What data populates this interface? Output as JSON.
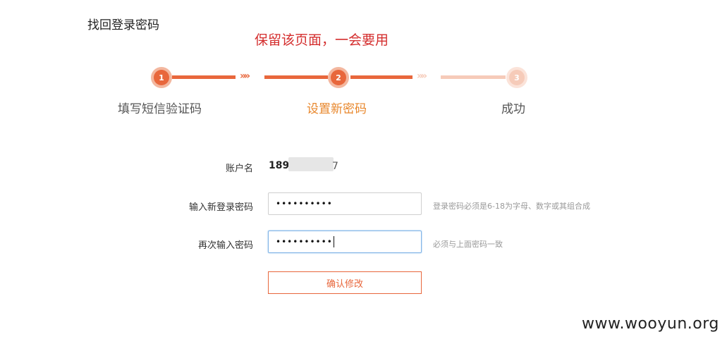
{
  "page": {
    "title": "找回登录密码"
  },
  "annotation": {
    "text": "保留该页面，一会要用"
  },
  "steps": [
    {
      "number": "1",
      "label": "填写短信验证码",
      "state": "done"
    },
    {
      "number": "2",
      "label": "设置新密码",
      "state": "current"
    },
    {
      "number": "3",
      "label": "成功",
      "state": "todo"
    }
  ],
  "stepper": {
    "arrows": "»»"
  },
  "form": {
    "account": {
      "label": "账户名",
      "value": "189",
      "tail": "7"
    },
    "new_password": {
      "label": "输入新登录密码",
      "value": "••••••••••",
      "hint": "登录密码必须是6-18为字母、数字或其组合成"
    },
    "confirm_password": {
      "label": "再次输入密码",
      "value": "••••••••••",
      "hint": "必须与上面密码一致"
    },
    "submit_label": "确认修改"
  },
  "watermark": {
    "text": "www.wooyun.org"
  },
  "colors": {
    "accent": "#e8673c",
    "accent_light": "#f6cbb9",
    "current_step": "#e8872c",
    "annotation": "#d42e2e"
  }
}
